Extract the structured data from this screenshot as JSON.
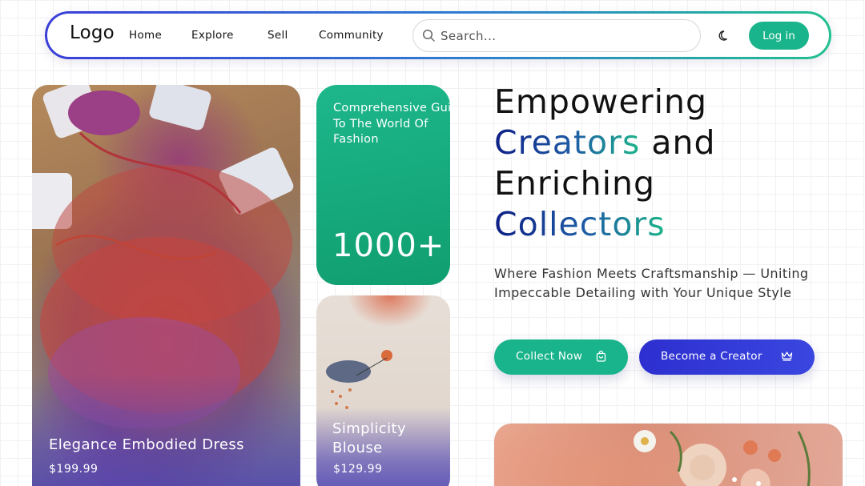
{
  "nav": {
    "logo": "Logo",
    "links": [
      "Home",
      "Explore",
      "Sell",
      "Community"
    ],
    "search_placeholder": "Search...",
    "login_label": "Log in"
  },
  "cards": {
    "featured": {
      "title": "Elegance Embodied Dress",
      "price": "$199.99"
    },
    "guide": {
      "title": "Comprehensive Guide To The World Of Fashion",
      "count": "1000+"
    },
    "blouse": {
      "title": "Simplicity Blouse",
      "price": "$129.99"
    }
  },
  "hero": {
    "line1": "Empowering",
    "word_creators": "Creators",
    "word_and": "and",
    "line3": "Enriching",
    "word_collectors": "Collectors",
    "subtitle": "Where Fashion Meets Craftsmanship — Uniting Impeccable Detailing with Your Unique Style",
    "collect_label": "Collect Now",
    "creator_label": "Become a Creator"
  },
  "colors": {
    "accent_green": "#19b48b",
    "accent_blue": "#2d2fcf",
    "heading_navy": "#0e1f86"
  },
  "icons": [
    "search-icon",
    "moon-icon",
    "shopping-bag-icon",
    "crown-icon"
  ]
}
